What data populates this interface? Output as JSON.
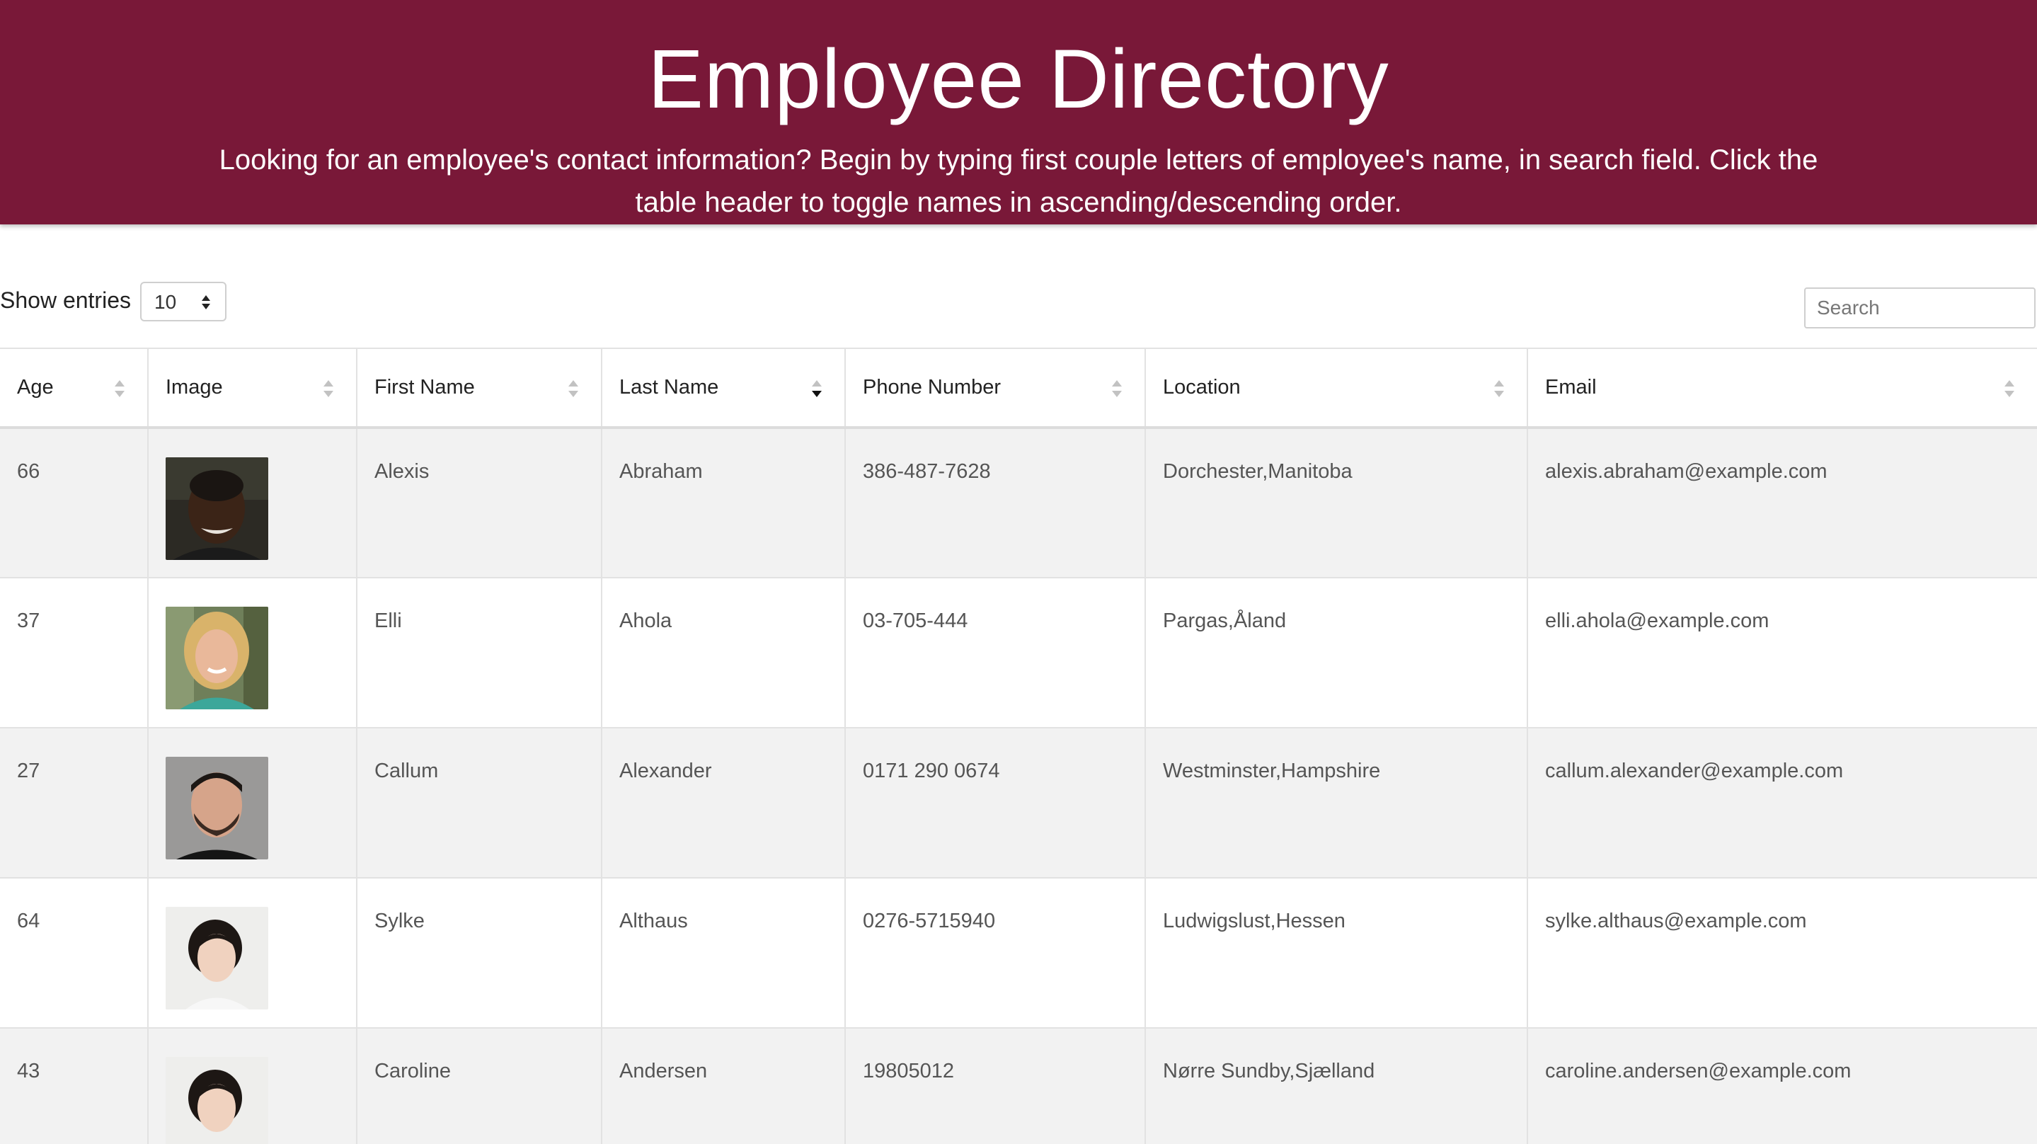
{
  "header": {
    "title": "Employee Directory",
    "subtitle": "Looking for an employee's contact information? Begin by typing first couple letters of employee's name, in search field. Click the table header to toggle names in ascending/descending order.",
    "background": "#791838"
  },
  "controls": {
    "show_entries_label": "Show entries",
    "entries_value": "10",
    "search_placeholder": "Search"
  },
  "table": {
    "columns": [
      "Age",
      "Image",
      "First Name",
      "Last Name",
      "Phone Number",
      "Location",
      "Email"
    ],
    "sorted_column": "Last Name",
    "sort_direction": "ascending",
    "rows": [
      {
        "age": "66",
        "avatar": "man-dark-skin-photo",
        "first": "Alexis",
        "last": "Abraham",
        "phone": "386-487-7628",
        "location": "Dorchester,Manitoba",
        "email": "alexis.abraham@example.com"
      },
      {
        "age": "37",
        "avatar": "woman-blonde-photo",
        "first": "Elli",
        "last": "Ahola",
        "phone": "03-705-444",
        "location": "Pargas,Åland",
        "email": "elli.ahola@example.com"
      },
      {
        "age": "27",
        "avatar": "man-beard-photo",
        "first": "Callum",
        "last": "Alexander",
        "phone": "0171 290 0674",
        "location": "Westminster,Hampshire",
        "email": "callum.alexander@example.com"
      },
      {
        "age": "64",
        "avatar": "woman-dark-hair-photo",
        "first": "Sylke",
        "last": "Althaus",
        "phone": "0276-5715940",
        "location": "Ludwigslust,Hessen",
        "email": "sylke.althaus@example.com"
      },
      {
        "age": "43",
        "avatar": "woman-dark-hair-photo",
        "first": "Caroline",
        "last": "Andersen",
        "phone": "19805012",
        "location": "Nørre Sundby,Sjælland",
        "email": "caroline.andersen@example.com"
      }
    ]
  }
}
